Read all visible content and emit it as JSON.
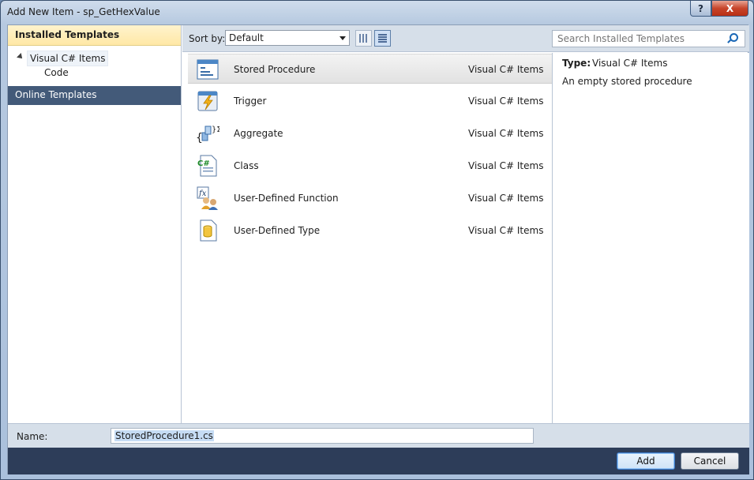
{
  "window": {
    "title": "Add New Item - sp_GetHexValue",
    "help_label": "?",
    "close_label": "X"
  },
  "left_panel": {
    "installed_header": "Installed Templates",
    "tree": [
      {
        "label": "Visual C# Items"
      },
      {
        "label": "Code"
      }
    ],
    "online_header": "Online Templates"
  },
  "sortbar": {
    "label": "Sort by:",
    "selected": "Default"
  },
  "templates": [
    {
      "name": "Stored Procedure",
      "category": "Visual C# Items",
      "icon": "stored-procedure-icon"
    },
    {
      "name": "Trigger",
      "category": "Visual C# Items",
      "icon": "trigger-icon"
    },
    {
      "name": "Aggregate",
      "category": "Visual C# Items",
      "icon": "aggregate-icon"
    },
    {
      "name": "Class",
      "category": "Visual C# Items",
      "icon": "class-icon"
    },
    {
      "name": "User-Defined Function",
      "category": "Visual C# Items",
      "icon": "function-icon"
    },
    {
      "name": "User-Defined Type",
      "category": "Visual C# Items",
      "icon": "type-icon"
    }
  ],
  "search": {
    "placeholder": "Search Installed Templates"
  },
  "details": {
    "type_label": "Type:",
    "type_value": "Visual C# Items",
    "description": "An empty stored procedure"
  },
  "name_field": {
    "label": "Name:",
    "value": "StoredProcedure1.cs"
  },
  "buttons": {
    "add": "Add",
    "cancel": "Cancel"
  }
}
